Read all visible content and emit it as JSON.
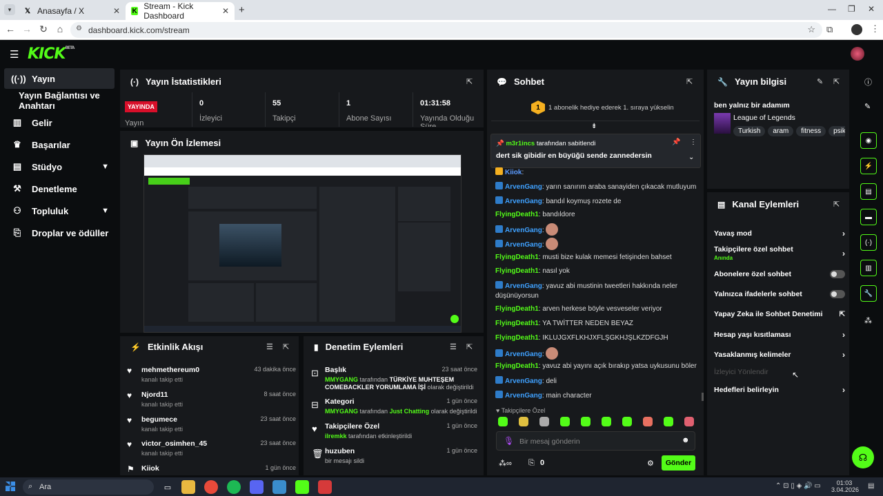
{
  "browser": {
    "tabs": [
      {
        "title": "Anasayfa / X"
      },
      {
        "title": "Stream - Kick Dashboard"
      }
    ],
    "url": "dashboard.kick.com/stream"
  },
  "kick": {
    "logo": "KICK",
    "logo_badge": "BETA"
  },
  "sidebar": {
    "items": [
      {
        "label": "Yayın",
        "icon": "stream-icon"
      },
      {
        "label": "Yayın Bağlantısı ve Anahtarı",
        "icon": ""
      },
      {
        "label": "Gelir",
        "icon": "chart-icon"
      },
      {
        "label": "Başarılar",
        "icon": "trophy-icon"
      },
      {
        "label": "Stüdyo",
        "icon": "studio-icon"
      },
      {
        "label": "Denetleme",
        "icon": "hammer-icon"
      },
      {
        "label": "Topluluk",
        "icon": "community-icon"
      },
      {
        "label": "Droplar ve ödüller",
        "icon": "gift-icon"
      }
    ]
  },
  "stats": {
    "title": "Yayın İstatistikleri",
    "live_badge": "YAYINDA",
    "live_label": "Yayın",
    "cells": [
      {
        "value": "0",
        "label": "İzleyici"
      },
      {
        "value": "55",
        "label": "Takipçi"
      },
      {
        "value": "1",
        "label": "Abone Sayısı"
      },
      {
        "value": "01:31:58",
        "label": "Yayında Olduğu Süre"
      }
    ]
  },
  "preview": {
    "title": "Yayın Ön İzlemesi"
  },
  "activity": {
    "title": "Etkinlik Akışı",
    "items": [
      {
        "name": "mehmethereum0",
        "sub": "kanalı takip etti",
        "time": "43 dakika önce"
      },
      {
        "name": "Njord11",
        "sub": "kanalı takip etti",
        "time": "8 saat önce"
      },
      {
        "name": "begumece",
        "sub": "kanalı takip etti",
        "time": "23 saat önce"
      },
      {
        "name": "victor_osimhen_45",
        "sub": "kanalı takip etti",
        "time": "23 saat önce"
      },
      {
        "name": "Kiiok",
        "sub": "",
        "time": "1 gün önce"
      }
    ]
  },
  "moderation": {
    "title": "Denetim Eylemleri",
    "items": [
      {
        "name": "Başlık",
        "time": "23 saat önce",
        "actor": "MMYGANG",
        "mid": "tarafından",
        "value": "TÜRKİYE MUHTEŞEM COMEBACKLER YORUMLAMA İŞİ",
        "end": "olarak değiştirildi"
      },
      {
        "name": "Kategori",
        "time": "1 gün önce",
        "actor": "MMYGANG",
        "mid": "tarafından",
        "value": "Just Chatting",
        "end": "olarak değiştirildi"
      },
      {
        "name": "Takipçilere Özel",
        "time": "1 gün önce",
        "actor": "ilremkk",
        "mid": "tarafından etkinleştirildi",
        "value": "",
        "end": ""
      },
      {
        "name": "huzuben",
        "time": "1 gün önce",
        "actor": "",
        "mid": "bir mesajı sildi",
        "value": "",
        "end": ""
      }
    ]
  },
  "chat": {
    "title": "Sohbet",
    "sub_gift": "1 abonelik hediye ederek 1. sıraya yükselin",
    "sub_rank": "1",
    "pinned_by": "m3r1incs",
    "pinned_label": "tarafından sabitlendi",
    "pinned_text": "dert sik gibidir en büyüğü sende zannedersin",
    "messages": [
      {
        "user": "Kiiok",
        "text": ":",
        "color": "#5b9bff"
      },
      {
        "user": "ArvenGang",
        "text": ": yarın sanırım araba sanayiden çıkacak mutluyum",
        "color": "#3fa1ff"
      },
      {
        "user": "ArvenGang",
        "text": ": bandıl koymuş rozete de",
        "color": "#3fa1ff"
      },
      {
        "user": "FlyingDeath1",
        "text": ": bandıldore",
        "color": "#53fc18"
      },
      {
        "user": "ArvenGang",
        "text": ":",
        "color": "#3fa1ff"
      },
      {
        "user": "ArvenGang",
        "text": ":",
        "color": "#3fa1ff"
      },
      {
        "user": "FlyingDeath1",
        "text": ": musti bize kulak memesi fetişinden bahset",
        "color": "#53fc18"
      },
      {
        "user": "FlyingDeath1",
        "text": ": nasıl yok",
        "color": "#53fc18"
      },
      {
        "user": "ArvenGang",
        "text": ": yavuz abi mustinin tweetleri hakkında neler düşünüyorsun",
        "color": "#3fa1ff"
      },
      {
        "user": "FlyingDeath1",
        "text": ": arven herkese böyle vesveseler veriyor",
        "color": "#53fc18"
      },
      {
        "user": "FlyingDeath1",
        "text": ": YA TWİTTER NEDEN BEYAZ",
        "color": "#53fc18"
      },
      {
        "user": "FlyingDeath1",
        "text": ": IKLUJGXFLKHJXFLŞGKHJŞLKZDFGJH",
        "color": "#53fc18"
      },
      {
        "user": "ArvenGang",
        "text": ":",
        "color": "#3fa1ff"
      },
      {
        "user": "FlyingDeath1",
        "text": ": yavuz abi yayını açık bırakıp yatsa uykusunu böler",
        "color": "#53fc18"
      },
      {
        "user": "ArvenGang",
        "text": ": deli",
        "color": "#3fa1ff"
      },
      {
        "user": "ArvenGang",
        "text": ": main character",
        "color": "#3fa1ff"
      }
    ],
    "followers_only": "Takipçilere Özel",
    "input_placeholder": "Bir mesaj gönderin",
    "send": "Gönder",
    "gift_count": "0"
  },
  "info": {
    "title": "Yayın bilgisi",
    "stream_title": "ben yalnız bir adamım",
    "category": "League of Legends",
    "tags": [
      "Turkish",
      "aram",
      "fitness",
      "psiko"
    ]
  },
  "channel_actions": {
    "title": "Kanal Eylemleri",
    "items": [
      {
        "label": "Yavaş mod",
        "type": "arrow"
      },
      {
        "label": "Takipçilere özel sohbet",
        "sub": "Anında",
        "type": "arrow"
      },
      {
        "label": "Abonelere özel sohbet",
        "type": "toggle"
      },
      {
        "label": "Yalnızca ifadelerle sohbet",
        "type": "toggle"
      },
      {
        "label": "Yapay Zeka ile Sohbet Denetimi",
        "type": "external"
      },
      {
        "label": "Hesap yaşı kısıtlaması",
        "type": "arrow"
      },
      {
        "label": "Yasaklanmış kelimeler",
        "type": "arrow"
      },
      {
        "label": "İzleyici Yönlendir",
        "type": "disabled"
      },
      {
        "label": "Hedefleri belirleyin",
        "type": "arrow"
      }
    ]
  },
  "taskbar": {
    "search": "Ara",
    "time": "01:03",
    "date": "3.04.2026"
  },
  "colors": {
    "accent": "#53fc18",
    "live": "#d80f2a",
    "panel": "#17191c",
    "bg": "#0b0d0f"
  }
}
